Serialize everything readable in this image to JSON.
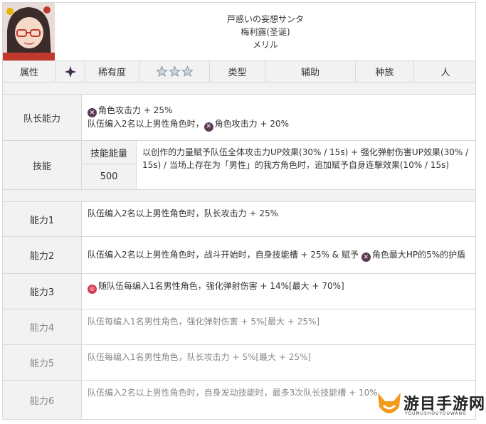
{
  "header": {
    "name_jp": "戸惑いの妄想サンタ",
    "name_cn": "梅利露(圣诞)",
    "name_kana": "メリル"
  },
  "attributes": {
    "attr_label": "属性",
    "rarity_label": "稀有度",
    "rarity_stars": 3,
    "type_label": "类型",
    "type_value": "辅助",
    "race_label": "种族",
    "race_value": "人"
  },
  "leader": {
    "label": "队长能力",
    "line1": "角色攻击力 + 25%",
    "line2_a": "队伍编入2名以上男性角色时，",
    "line2_b": "角色攻击力 + 20%"
  },
  "skill": {
    "label": "技能",
    "energy_label": "技能能量",
    "energy_value": "500",
    "desc": "以创作的力量赋予队伍全体攻击力UP效果(30% / 15s) + 强化弹射伤害UP效果(30% / 15s) / 当场上存在为「男性」的我方角色时，追加赋予自身连擊效果(10% / 15s)"
  },
  "abilities": [
    {
      "label": "能力1",
      "text": "队伍编入2名以上男性角色时，队长攻击力 + 25%"
    },
    {
      "label": "能力2",
      "text_a": "队伍编入2名以上男性角色时，战斗开始时，自身技能槽 + 25% & 赋予",
      "text_b": "角色最大HP的5%的护盾"
    },
    {
      "label": "能力3",
      "text": "随队伍每编入1名男性角色，强化弹射伤害 + 14%[最大 + 70%]"
    },
    {
      "label": "能力4",
      "text": "队伍每编入1名男性角色，强化弹射伤害 + 5%[最大 + 25%]"
    },
    {
      "label": "能力5",
      "text": "队伍每编入1名男性角色，队长攻击力 + 5%[最大 + 25%]"
    },
    {
      "label": "能力6",
      "text": "队伍编入2名以上男性角色时，自身发动技能时，最多3次队长技能槽 + 10%"
    }
  ],
  "watermark": {
    "title": "游目手游网",
    "sub": "YOUMUSHOUYOUWANG"
  },
  "colors": {
    "attr_icon": "#5a3b55",
    "ring_icon": "#d23b54",
    "logo_orange": "#f39a1e"
  }
}
